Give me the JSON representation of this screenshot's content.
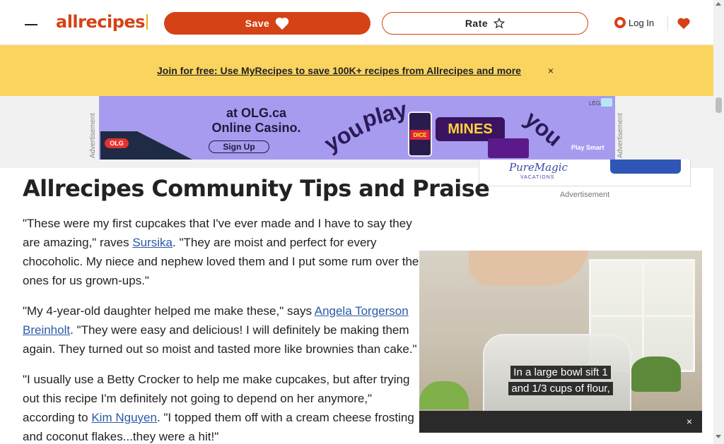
{
  "header": {
    "menu_icon": "hamburger-menu-icon",
    "logo_text": "allrecipes",
    "save_label": "Save",
    "save_icon": "heart-icon",
    "rate_label": "Rate",
    "rate_icon": "star-outline-icon",
    "login_label": "Log In",
    "login_icon": "user-circle-icon",
    "saved_icon": "heart-icon",
    "brand_color": "#d54215"
  },
  "banner": {
    "link_text": "Join for free: Use MyRecipes to save 100K+ recipes from Allrecipes and more",
    "close_glyph": "×",
    "background": "#fbd45f"
  },
  "ad": {
    "label": "Advertisement",
    "headline_line1": "at OLG.ca",
    "headline_line2": "Online Casino.",
    "signup_label": "Sign Up",
    "olg_logo": "OLG",
    "word_you": "you",
    "word_play": "play",
    "dice_label": "DICE",
    "mines_label": "MINES",
    "play_smart": "Play Smart",
    "legal": "LEGAL"
  },
  "side_ad": {
    "brand": "PureMagic",
    "sub": "VACATIONS",
    "label": "Advertisement"
  },
  "article": {
    "title": "Allrecipes Community Tips and Praise",
    "p1_before": "\"These were my first cupcakes that I've ever made and I have to say they are amazing,\" raves ",
    "p1_link": "Sursika",
    "p1_after": ". \"They are moist and perfect for every chocoholic. My niece and nephew loved them and I put some rum over the ones for us grown-ups.\"",
    "p2_before": "\"My 4-year-old daughter helped me make these,\" says ",
    "p2_link": "Angela Torgerson Breinholt",
    "p2_after": ". \"They were easy and delicious! I will definitely be making them again. They turned out so moist and tasted more like brownies than cake.\"",
    "p3_before": "\"I usually use a Betty Crocker to help me make cupcakes, but after trying out this recipe I'm definitely not going to depend on her anymore,\" according to ",
    "p3_link": "Kim Nguyen",
    "p3_after": ". \"I topped them off with a cream cheese frosting and coconut flakes...they were a hit!\""
  },
  "video": {
    "caption_line1": "In a large bowl sift 1",
    "caption_line2": "and 1/3 cups of flour,",
    "close_glyph": "×"
  }
}
